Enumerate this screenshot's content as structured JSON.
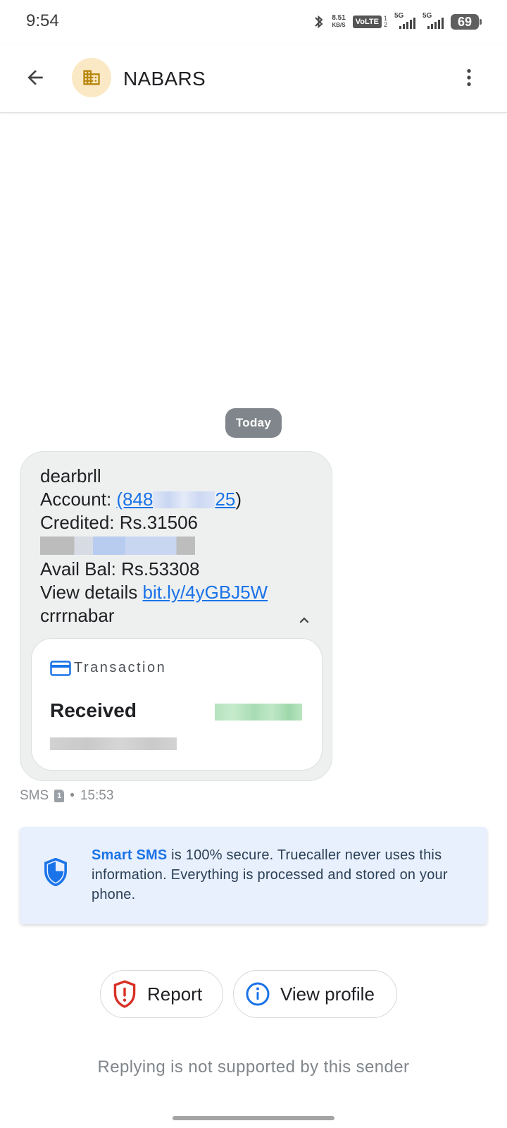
{
  "status_bar": {
    "time": "9:54",
    "net_speed_value": "8.51",
    "net_speed_unit": "KB/S",
    "volte_label": "VoLTE",
    "volte_sub": "1\n2",
    "sim1_network": "5G",
    "sim2_network": "5G",
    "battery_level": "69"
  },
  "header": {
    "sender_name": "NABARS",
    "back_icon": "arrow-back-icon",
    "avatar_icon": "business-building-icon",
    "avatar_bg": "#fbe9c6",
    "avatar_fg": "#b8860b",
    "more_icon": "more-vert-icon"
  },
  "conversation": {
    "date_chip": "Today",
    "message": {
      "line1": "dearbrll",
      "account_label": "Account: ",
      "account_prefix": "(848",
      "account_suffix": "25",
      "account_close": ")",
      "credited": "Credited: Rs.31506",
      "avail_bal": "Avail Bal: Rs.53308",
      "view_details_label": "View details ",
      "view_details_link": "bit.ly/4yGBJ5W",
      "signature": "crrrnabar",
      "link_color": "#1a73e8"
    },
    "transaction_card": {
      "title": "Transaction",
      "status": "Received",
      "icon": "credit-card-icon"
    },
    "meta": {
      "type": "SMS",
      "sim": "1",
      "separator": "•",
      "time": "15:53"
    }
  },
  "info_card": {
    "brand": "Smart SMS",
    "text": " is 100% secure. Truecaller never uses this information. Everything is processed and stored on your phone.",
    "icon": "shield-check-icon",
    "bg": "#e8f0fe"
  },
  "actions": {
    "report_label": "Report",
    "view_profile_label": "View profile"
  },
  "footer_note": "Replying is not supported by this sender"
}
